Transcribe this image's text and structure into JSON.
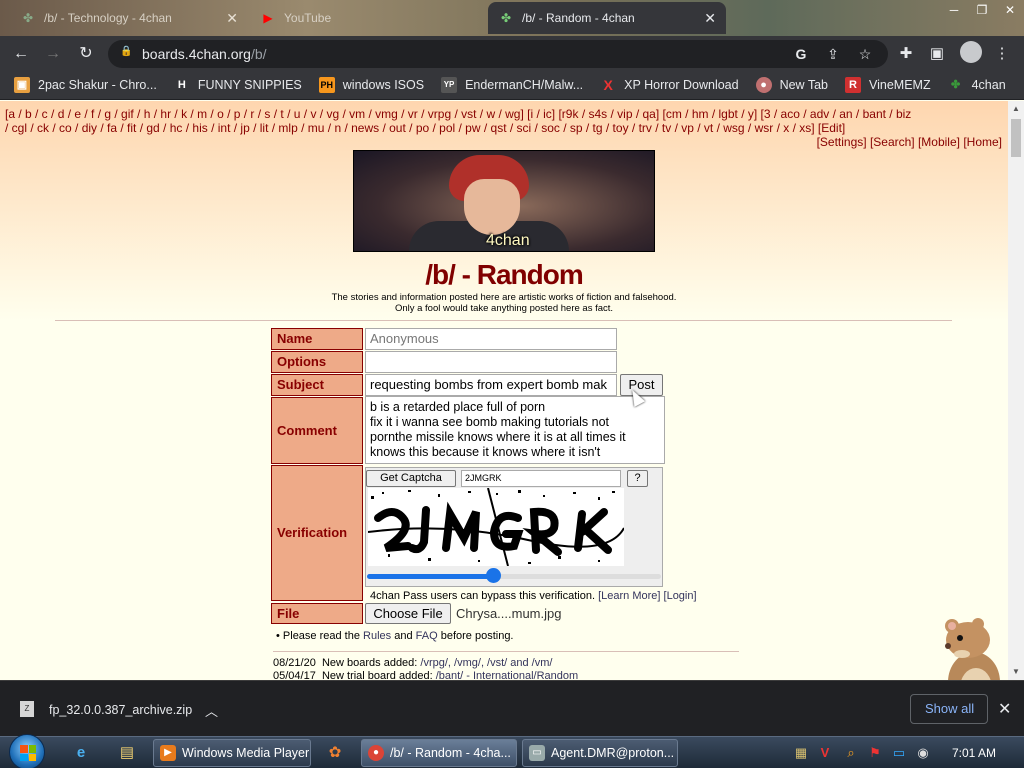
{
  "browser": {
    "tabs": [
      {
        "title": "/b/ - Technology - 4chan",
        "icon": "clover-icon"
      },
      {
        "title": "YouTube",
        "icon": "youtube-icon"
      },
      {
        "title": "/b/ - Random - 4chan",
        "icon": "clover-icon",
        "active": true
      }
    ],
    "url_host": "boards.4chan.org",
    "url_path": "/b/",
    "bookmarks": [
      {
        "label": "2pac Shakur - Chro...",
        "icon": "bookmark-icon",
        "color": "#e8a040"
      },
      {
        "label": "FUNNY SNIPPIES",
        "icon": "H",
        "color": "#ffffff"
      },
      {
        "label": "windows ISOS",
        "icon": "PH",
        "color": "#f7971d"
      },
      {
        "label": "EndermanCH/Malw...",
        "icon": "YP",
        "color": "#555555"
      },
      {
        "label": "XP Horror Download",
        "icon": "X",
        "color": "#e33"
      },
      {
        "label": "New Tab",
        "icon": "globe-icon",
        "color": "#c07070"
      },
      {
        "label": "VineMEMZ",
        "icon": "R",
        "color": "#d03030"
      },
      {
        "label": "4chan",
        "icon": "clover-icon",
        "color": "#3a9a3a"
      }
    ]
  },
  "boardlist": {
    "row1": "[a / b / c / d / e / f / g / gif / h / hr / k / m / o / p / r / s / t / u / v / vg / vm / vmg / vr / vrpg / vst / w / wg] [i / ic] [r9k / s4s / vip / qa] [cm / hm / lgbt / y] [3 / aco / adv / an / bant / biz",
    "row2": "/ cgl / ck / co / diy / fa / fit / gd / hc / his / int / jp / lit / mlp / mu / n / news / out / po / pol / pw / qst / sci / soc / sp / tg / toy / trv / tv / vp / vt / wsg / wsr / x / xs] [Edit]",
    "right": "[Settings] [Search] [Mobile] [Home]"
  },
  "banner_text": "4chan",
  "board_title": "/b/ - Random",
  "disclaimer_1": "The stories and information posted here are artistic works of fiction and falsehood.",
  "disclaimer_2": "Only a fool would take anything posted here as fact.",
  "form": {
    "name_label": "Name",
    "name_placeholder": "Anonymous",
    "options_label": "Options",
    "options_value": "",
    "subject_label": "Subject",
    "subject_value": "requesting bombs from expert bomb mak",
    "post_button": "Post",
    "comment_label": "Comment",
    "comment_lines": [
      "b is a retarded place full of porn",
      "fix it i wanna see bomb making tutorials not",
      "pornthe missile knows where it is at all times it",
      "knows this because it knows where it isn't"
    ],
    "verification_label": "Verification",
    "get_captcha_button": "Get Captcha",
    "captcha_value": "2JMGRK",
    "help_button": "?",
    "captcha_slider_fraction": 0.43,
    "pass_text": "4chan Pass users can bypass this verification.",
    "learn_more": "[Learn More]",
    "login": "[Login]",
    "file_label": "File",
    "choose_file_button": "Choose File",
    "file_name": "Chrysa....mum.jpg",
    "rules_prefix": "• Please read the",
    "rules_link": "Rules",
    "rules_and": "and",
    "faq_link": "FAQ",
    "rules_suffix": "before posting."
  },
  "news": [
    {
      "date": "08/21/20",
      "text": "New boards added:",
      "links": "/vrpg/, /vmg/, /vst/ and /vm/"
    },
    {
      "date": "05/04/17",
      "text": "New trial board added:",
      "links": "/bant/ - International/Random"
    }
  ],
  "download": {
    "file": "fp_32.0.0.387_archive.zip",
    "show_all": "Show all"
  },
  "taskbar": {
    "items": [
      {
        "label": "Windows Media Player",
        "icon": "media-player-icon",
        "color": "#e87b1d"
      },
      {
        "label": "/b/ - Random - 4cha...",
        "icon": "chrome-icon",
        "color": "#db4437",
        "active": true
      },
      {
        "label": "Agent.DMR@proton...",
        "icon": "window-icon",
        "color": "#9aa"
      }
    ],
    "clock": "7:01 AM"
  }
}
